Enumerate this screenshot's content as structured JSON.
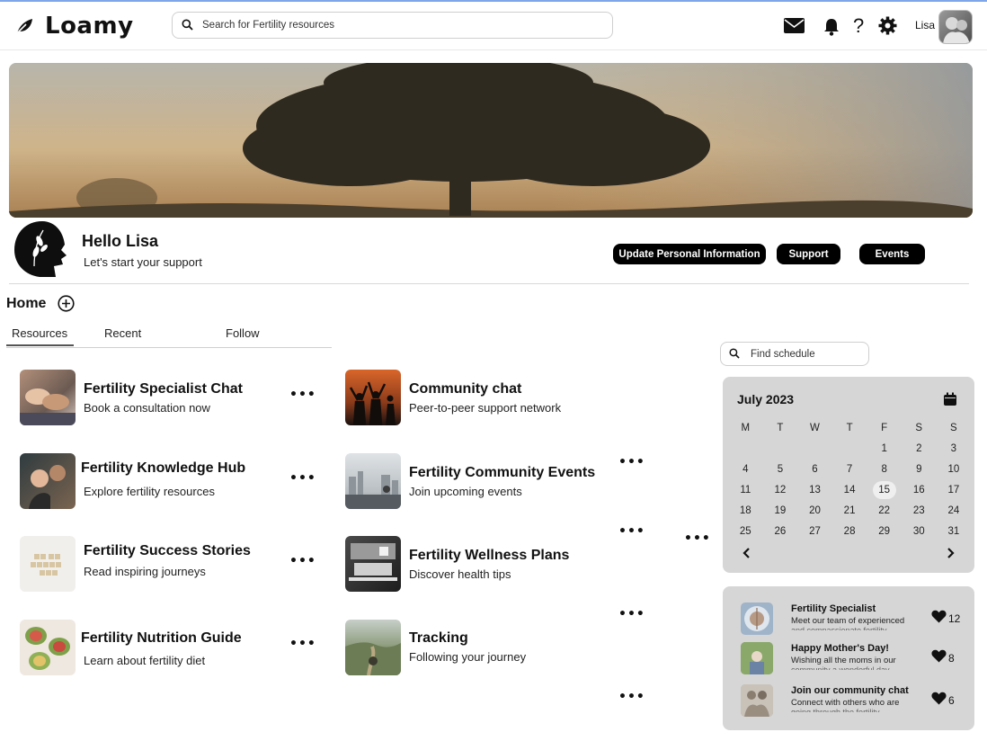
{
  "app": {
    "name": "Loamy"
  },
  "search": {
    "placeholder": "Search for Fertility resources"
  },
  "header": {
    "user_name": "Lisa"
  },
  "profile": {
    "greeting": "Hello Lisa",
    "subtitle": "Let's start your support"
  },
  "actions": {
    "update_info": "Update Personal Information",
    "support": "Support",
    "events": "Events"
  },
  "home": {
    "title": "Home"
  },
  "tabs": [
    {
      "label": "Resources"
    },
    {
      "label": "Recent"
    },
    {
      "label": "Follow"
    }
  ],
  "resources": [
    {
      "title": "Fertility Specialist Chat",
      "subtitle": "Book a consultation now"
    },
    {
      "title": "Fertility Knowledge Hub",
      "subtitle": "Explore fertility resources"
    },
    {
      "title": "Fertility Success Stories",
      "subtitle": "Read inspiring journeys"
    },
    {
      "title": "Fertility Nutrition Guide",
      "subtitle": "Learn about fertility diet"
    },
    {
      "title": "Community chat",
      "subtitle": "Peer-to-peer support network"
    },
    {
      "title": "Fertility Community Events",
      "subtitle": "Join upcoming events"
    },
    {
      "title": "Fertility Wellness Plans",
      "subtitle": "Discover health tips"
    },
    {
      "title": "Tracking",
      "subtitle": "Following your journey"
    }
  ],
  "more_label": "•••",
  "schedule": {
    "placeholder": "Find schedule"
  },
  "calendar": {
    "month": "July 2023",
    "weekdays": [
      "M",
      "T",
      "W",
      "T",
      "F",
      "S",
      "S"
    ],
    "weeks": [
      [
        "",
        "",
        "",
        "",
        "1",
        "2",
        "3"
      ],
      [
        "4",
        "5",
        "6",
        "7",
        "8",
        "9",
        "10"
      ],
      [
        "11",
        "12",
        "13",
        "14",
        "15",
        "16",
        "17"
      ],
      [
        "18",
        "19",
        "20",
        "21",
        "22",
        "23",
        "24"
      ],
      [
        "25",
        "26",
        "27",
        "28",
        "29",
        "30",
        "31"
      ]
    ],
    "today": "15"
  },
  "feed": [
    {
      "title": "Fertility Specialist",
      "subtitle": "Meet our team of experienced",
      "subtitle_cut": "and compassionate fertility",
      "likes": "12"
    },
    {
      "title": "Happy Mother's Day!",
      "subtitle": "Wishing all the moms in our",
      "subtitle_cut": "community a wonderful day",
      "likes": "8"
    },
    {
      "title": "Join our community chat",
      "subtitle": "Connect with others who are",
      "subtitle_cut": "going through the fertility",
      "likes": "6"
    }
  ],
  "colors": {
    "accent": "#000000",
    "panel": "#d6d6d6",
    "topline": "#7fa6e8"
  }
}
